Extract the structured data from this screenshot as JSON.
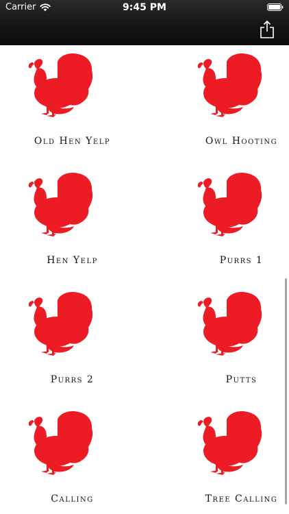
{
  "status_bar": {
    "carrier": "Carrier",
    "time": "9:45 PM"
  },
  "icons": {
    "wifi": "wifi-icon",
    "battery": "battery-icon",
    "share": "share-icon",
    "tile": "turkey-icon"
  },
  "colors": {
    "turkey": "#ed1c24",
    "navbar": "#151515"
  },
  "sounds": [
    {
      "label": "Old Hen Yelp"
    },
    {
      "label": "Owl Hooting"
    },
    {
      "label": "Hen Yelp"
    },
    {
      "label": "Purrs 1"
    },
    {
      "label": "Purrs 2"
    },
    {
      "label": "Putts"
    },
    {
      "label": "Calling"
    },
    {
      "label": "Tree Calling"
    }
  ]
}
